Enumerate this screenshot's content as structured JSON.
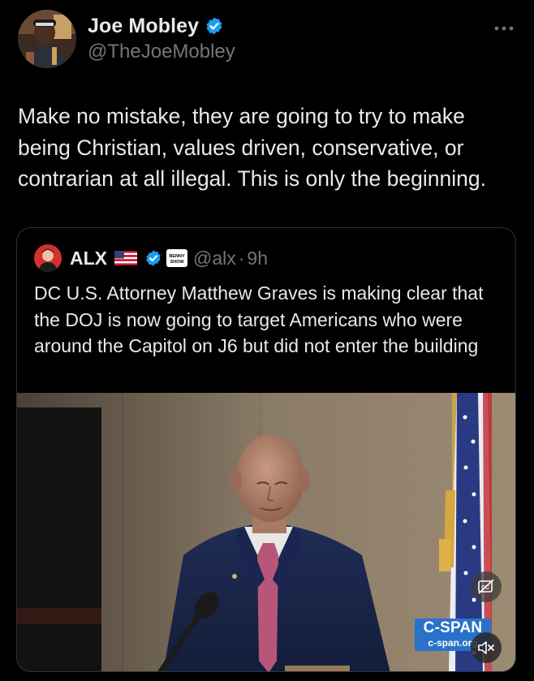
{
  "author": {
    "display_name": "Joe Mobley",
    "handle": "@TheJoeMobley",
    "verified_icon": "verified-badge-icon",
    "more_icon": "more-horizontal-icon"
  },
  "tweet": {
    "text": "Make no mistake, they are going to try to make being Christian, values driven, conservative, or contrarian at all illegal. This is only the beginning."
  },
  "quote": {
    "display_name": "ALX",
    "flag_icon": "us-flag-icon",
    "verified_icon": "verified-badge-icon",
    "affiliate_badge_text": "BENNY SHOW",
    "handle": "@alx",
    "separator": "·",
    "time": "9h",
    "text": "DC U.S. Attorney Matthew Graves is making clear that the DOJ is now going to target Americans who were around the Capitol on J6 but did not enter the building",
    "media": {
      "type": "video",
      "watermark_logo": "C-SPAN",
      "watermark_url": "c-span.org",
      "captions_icon": "captions-icon",
      "mute_icon": "volume-muted-icon"
    }
  },
  "colors": {
    "background": "#000000",
    "text_primary": "#e7e9ea",
    "text_secondary": "#71767b",
    "border": "#2f3336",
    "verified_blue": "#1d9bf0",
    "cspan_blue": "#2a72c9"
  }
}
